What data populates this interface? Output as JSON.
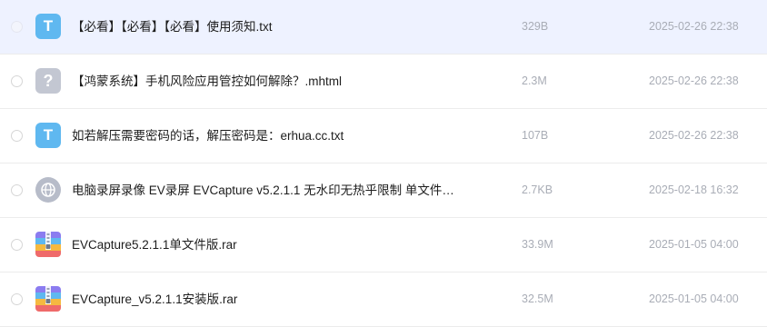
{
  "files": [
    {
      "name": "【必看】【必看】【必看】使用须知.txt",
      "size": "329B",
      "date": "2025-02-26 22:38",
      "icon": "txt-file-icon",
      "icon_glyph": "T"
    },
    {
      "name": "【鸿蒙系统】手机风险应用管控如何解除？.mhtml",
      "size": "2.3M",
      "date": "2025-02-26 22:38",
      "icon": "unknown-file-icon",
      "icon_glyph": "?"
    },
    {
      "name": "如若解压需要密码的话，解压密码是：erhua.cc.txt",
      "size": "107B",
      "date": "2025-02-26 22:38",
      "icon": "txt-file-icon",
      "icon_glyph": "T"
    },
    {
      "name": "电脑录屏录像 EV录屏 EVCapture v5.2.1.1 无水印无热乎限制 单文件…",
      "size": "2.7KB",
      "date": "2025-02-18 16:32",
      "icon": "web-link-icon"
    },
    {
      "name": "EVCapture5.2.1.1单文件版.rar",
      "size": "33.9M",
      "date": "2025-01-05 04:00",
      "icon": "rar-archive-icon"
    },
    {
      "name": "EVCapture_v5.2.1.1安装版.rar",
      "size": "32.5M",
      "date": "2025-01-05 04:00",
      "icon": "rar-archive-icon"
    }
  ],
  "colors": {
    "hover_row": "#eef2ff",
    "txt_icon": "#5fb8f0",
    "unknown_icon": "#c3c7d2",
    "meta_text": "#a9adb6"
  }
}
